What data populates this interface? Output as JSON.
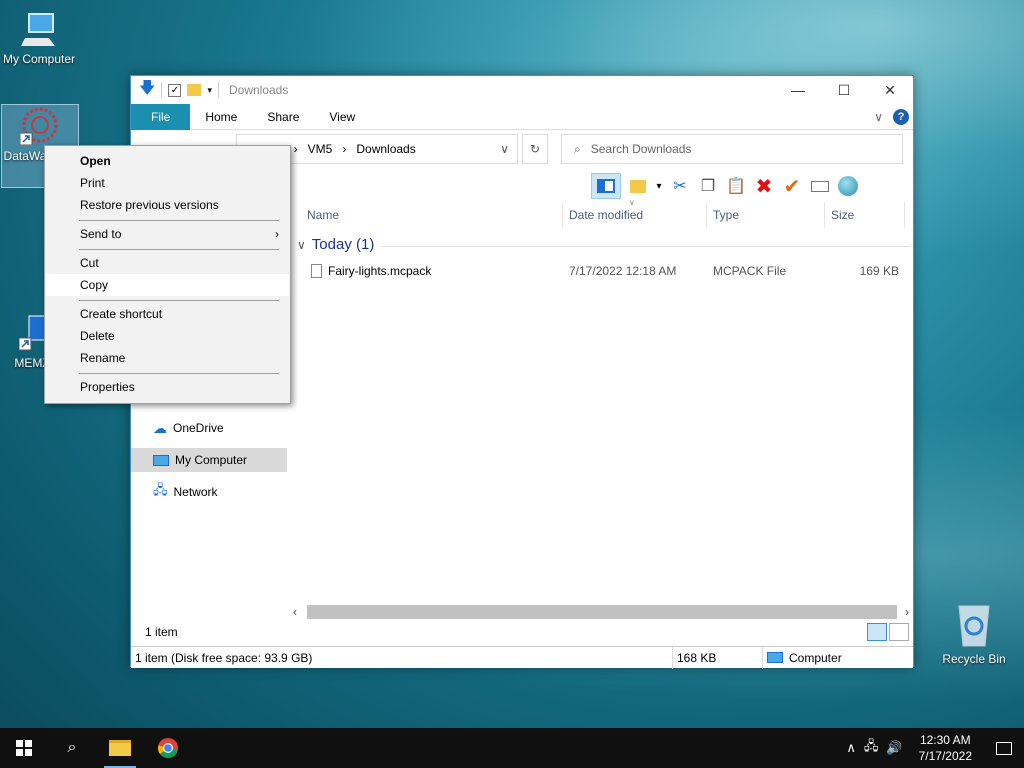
{
  "desktop": {
    "icons": [
      {
        "label": "My Computer"
      },
      {
        "label": "DataWa... om"
      },
      {
        "label": "MEMZ-..."
      },
      {
        "label": "Recycle Bin"
      }
    ]
  },
  "window": {
    "title": "Downloads",
    "ribbon_tabs": [
      "File",
      "Home",
      "Share",
      "View"
    ],
    "breadcrumb": [
      "Users",
      "VM5",
      "Downloads"
    ],
    "breadcrumb_first_visible": "ers",
    "search_placeholder": "Search Downloads",
    "columns": [
      "Name",
      "Date modified",
      "Type",
      "Size"
    ],
    "group_label": "Today (1)",
    "files": [
      {
        "name": "Fairy-lights.mcpack",
        "date": "7/17/2022 12:18 AM",
        "type": "MCPACK File",
        "size": "169 KB"
      }
    ],
    "nav": [
      {
        "label": "OneDrive"
      },
      {
        "label": "My Computer"
      },
      {
        "label": "Network"
      }
    ],
    "item_count": "1 item",
    "status": {
      "left": "1 item (Disk free space: 93.9 GB)",
      "size": "168 KB",
      "location": "Computer"
    }
  },
  "context_menu": {
    "items": {
      "open": "Open",
      "print": "Print",
      "restore": "Restore previous versions",
      "send_to": "Send to",
      "cut": "Cut",
      "copy": "Copy",
      "create_shortcut": "Create shortcut",
      "delete": "Delete",
      "rename": "Rename",
      "properties": "Properties"
    },
    "highlighted": "Copy"
  },
  "taskbar": {
    "time": "12:30 AM",
    "date": "7/17/2022"
  },
  "colors": {
    "accent": "#1a8fb0",
    "selection": "#cde6f7",
    "taskbar": "#101010"
  }
}
